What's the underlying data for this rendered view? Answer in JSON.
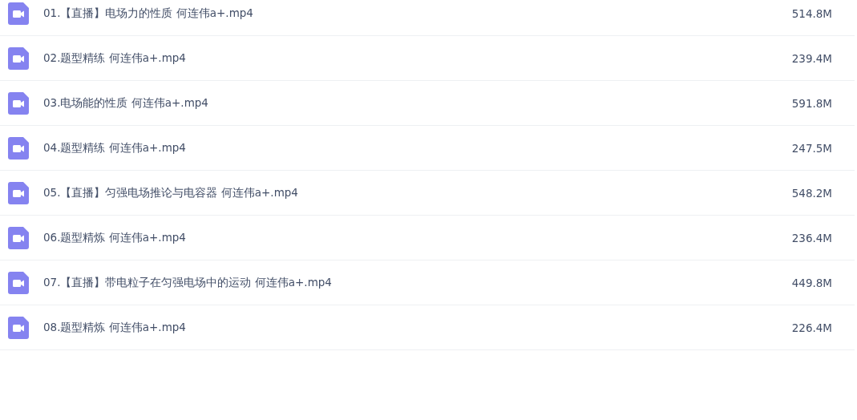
{
  "files": [
    {
      "name": "01.【直播】电场力的性质 何连伟a+.mp4",
      "size": "514.8M"
    },
    {
      "name": "02.题型精练 何连伟a+.mp4",
      "size": "239.4M"
    },
    {
      "name": "03.电场能的性质 何连伟a+.mp4",
      "size": "591.8M"
    },
    {
      "name": "04.题型精练 何连伟a+.mp4",
      "size": "247.5M"
    },
    {
      "name": "05.【直播】匀强电场推论与电容器 何连伟a+.mp4",
      "size": "548.2M"
    },
    {
      "name": "06.题型精炼 何连伟a+.mp4",
      "size": "236.4M"
    },
    {
      "name": "07.【直播】带电粒子在匀强电场中的运动 何连伟a+.mp4",
      "size": "449.8M"
    },
    {
      "name": "08.题型精炼 何连伟a+.mp4",
      "size": "226.4M"
    }
  ]
}
